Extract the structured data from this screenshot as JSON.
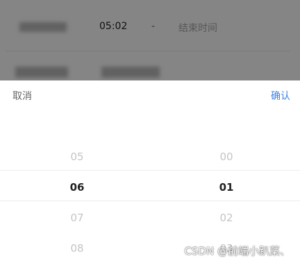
{
  "background_form": {
    "row1": {
      "time": "05:02",
      "separator": "-",
      "end_placeholder": "结束时间"
    }
  },
  "picker": {
    "cancel_label": "取消",
    "confirm_label": "确认",
    "hours": [
      "05",
      "06",
      "07",
      "08"
    ],
    "minutes": [
      "00",
      "01",
      "02",
      "03"
    ],
    "selected_hour": "06",
    "selected_minute": "01"
  },
  "watermark": "CSDN @前端小趴菜、",
  "colors": {
    "accent": "#3b82e6",
    "overlay": "rgba(0,0,0,0.48)"
  }
}
